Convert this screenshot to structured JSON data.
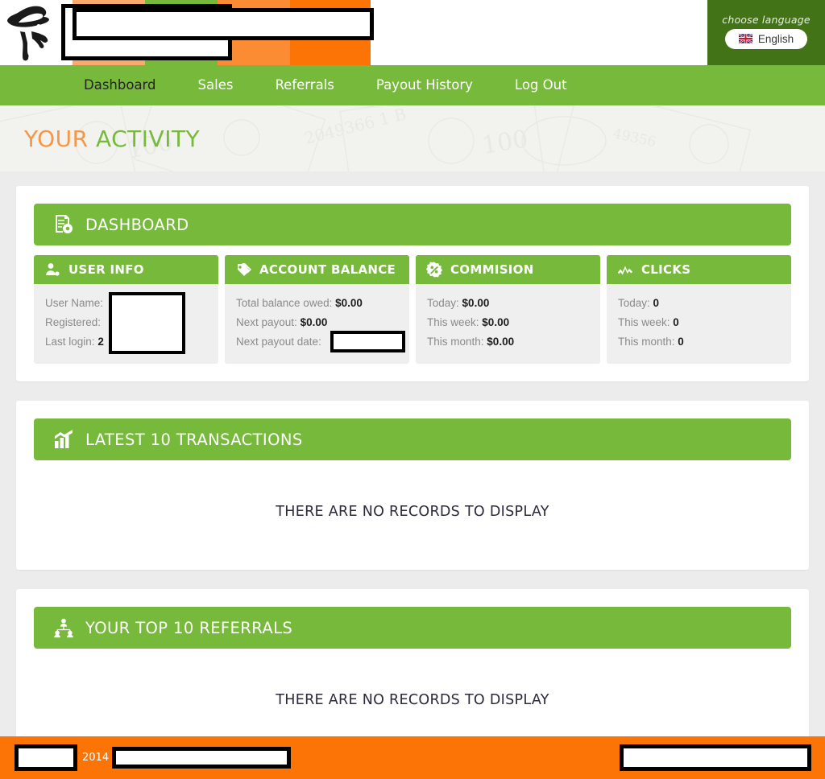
{
  "header": {
    "logo_alt": "hat-figure-logo",
    "logo_redaction": "",
    "banner_redaction": "",
    "language": {
      "title": "choose language",
      "selected": "English",
      "flag": "uk-flag"
    },
    "color_blocks": [
      "#fbaa6e",
      "#76b93b",
      "#fb8c34",
      "#fc7405"
    ]
  },
  "nav": {
    "items": [
      {
        "label": "Dashboard",
        "active": true
      },
      {
        "label": "Sales",
        "active": false
      },
      {
        "label": "Referrals",
        "active": false
      },
      {
        "label": "Payout History",
        "active": false
      },
      {
        "label": "Log Out",
        "active": false
      }
    ]
  },
  "banner": {
    "title_part1": "YOUR",
    "title_part2": "ACTIVITY",
    "color_part1": "#f79646",
    "color_part2": "#76b93b"
  },
  "dashboard": {
    "bar_title": "DASHBOARD",
    "bar_icon": "document-gear-icon",
    "cards": [
      {
        "title": "USER INFO",
        "icon": "user-icon",
        "rows": [
          {
            "label": "User Name:",
            "value": ""
          },
          {
            "label": "Registered:",
            "value": ""
          },
          {
            "label": "Last login:",
            "value": "2"
          }
        ]
      },
      {
        "title": "ACCOUNT BALANCE",
        "icon": "tags-icon",
        "rows": [
          {
            "label": "Total balance owed:",
            "value": "$0.00"
          },
          {
            "label": "Next payout:",
            "value": "$0.00"
          },
          {
            "label": "Next payout date:",
            "value": ""
          }
        ]
      },
      {
        "title": "COMMISION",
        "icon": "percent-badge-icon",
        "rows": [
          {
            "label": "Today:",
            "value": "$0.00"
          },
          {
            "label": "This week:",
            "value": "$0.00"
          },
          {
            "label": "This month:",
            "value": "$0.00"
          }
        ]
      },
      {
        "title": "CLICKS",
        "icon": "line-chart-icon",
        "rows": [
          {
            "label": "Today:",
            "value": "0"
          },
          {
            "label": "This week:",
            "value": "0"
          },
          {
            "label": "This month:",
            "value": "0"
          }
        ]
      }
    ]
  },
  "transactions": {
    "bar_title": "LATEST 10 TRANSACTIONS",
    "bar_icon": "bar-chart-icon",
    "empty_message": "THERE ARE NO RECORDS TO DISPLAY"
  },
  "referrals": {
    "bar_title": "YOUR TOP 10 REFERRALS",
    "bar_icon": "network-users-icon",
    "empty_message": "THERE ARE NO RECORDS TO DISPLAY"
  },
  "footer": {
    "year": "2014",
    "left_redaction": "",
    "mid_redaction": "",
    "right_redaction": "",
    "background": "#fc7405"
  }
}
